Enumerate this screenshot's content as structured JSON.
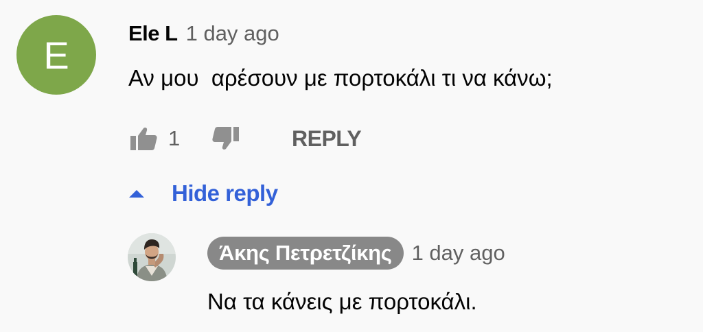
{
  "comment": {
    "avatar_letter": "E",
    "avatar_color": "#7ea74a",
    "author": "Ele L",
    "time": "1 day ago",
    "text": "Αν μου  αρέσουν με πορτοκάλι τι να κάνω;",
    "like_count": "1",
    "like_icon": "thumb-up-icon",
    "dislike_icon": "thumb-down-icon",
    "reply_label": "REPLY"
  },
  "replies_toggle": {
    "label": "Hide reply",
    "icon": "caret-up-icon",
    "color": "#3361d8"
  },
  "reply": {
    "author": "Άκης Πετρετζίκης",
    "author_chip_color": "#888888",
    "time": "1 day ago",
    "text": "Να τα κάνεις με πορτοκάλι."
  }
}
